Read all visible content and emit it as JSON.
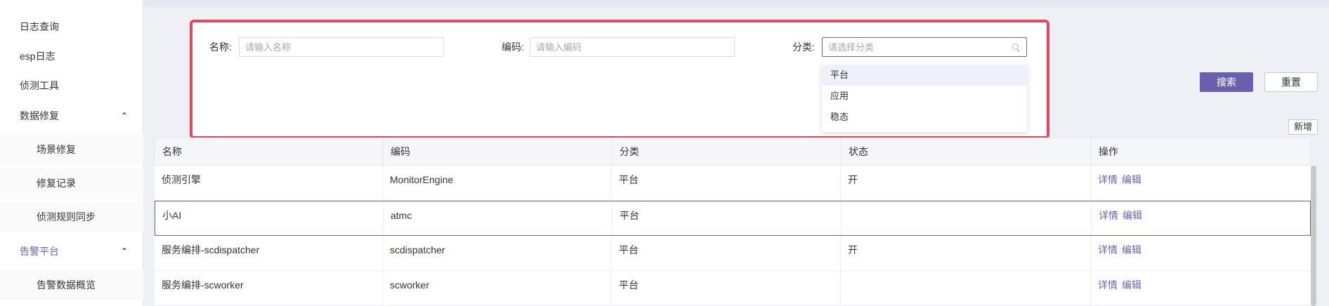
{
  "sidebar": {
    "items": [
      {
        "label": "日志查询"
      },
      {
        "label": "esp日志"
      },
      {
        "label": "侦测工具"
      },
      {
        "label": "数据修复",
        "caret": "⌃"
      },
      {
        "label": "场景修复"
      },
      {
        "label": "修复记录"
      },
      {
        "label": "侦测规则同步"
      },
      {
        "label": "告警平台",
        "caret": "⌃"
      },
      {
        "label": "告警数据概览"
      }
    ]
  },
  "search": {
    "name_label": "名称:",
    "name_placeholder": "请输入名称",
    "code_label": "编码:",
    "code_placeholder": "请输入编码",
    "category_label": "分类:",
    "category_placeholder": "请选择分类",
    "category_options": [
      "平台",
      "应用",
      "稳态"
    ]
  },
  "buttons": {
    "search": "搜索",
    "reset": "重置",
    "add": "新增"
  },
  "table": {
    "columns": [
      "名称",
      "编码",
      "分类",
      "状态",
      "操作"
    ],
    "rows": [
      {
        "name": "侦测引擎",
        "code": "MonitorEngine",
        "category": "平台",
        "status": "开",
        "actions": [
          "详情",
          "编辑"
        ]
      },
      {
        "name": "小AI",
        "code": "atmc",
        "category": "平台",
        "status": "",
        "actions": [
          "详情",
          "编辑"
        ]
      },
      {
        "name": "服务编排-scdispatcher",
        "code": "scdispatcher",
        "category": "平台",
        "status": "开",
        "actions": [
          "详情",
          "编辑"
        ]
      },
      {
        "name": "服务编排-scworker",
        "code": "scworker",
        "category": "平台",
        "status": "",
        "actions": [
          "详情",
          "编辑"
        ]
      }
    ]
  },
  "colors": {
    "accent": "#6b5fb0",
    "highlight_border": "#e6475e"
  }
}
